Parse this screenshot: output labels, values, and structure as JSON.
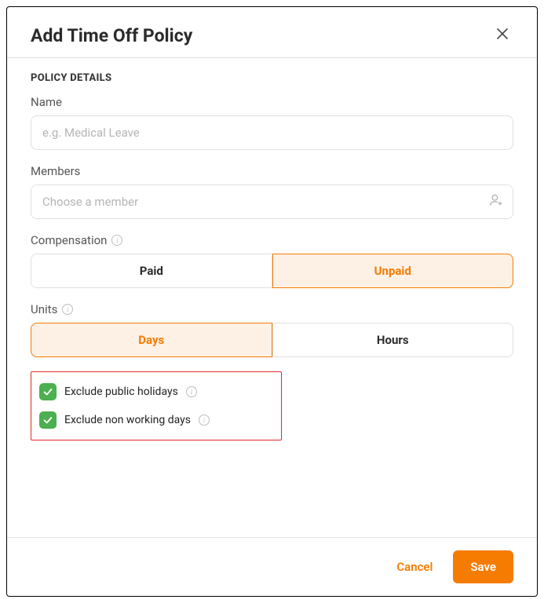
{
  "header": {
    "title": "Add Time Off Policy"
  },
  "section": {
    "heading": "POLICY DETAILS"
  },
  "name": {
    "label": "Name",
    "placeholder": "e.g. Medical Leave",
    "value": ""
  },
  "members": {
    "label": "Members",
    "placeholder": "Choose a member",
    "value": ""
  },
  "compensation": {
    "label": "Compensation",
    "options": {
      "paid": "Paid",
      "unpaid": "Unpaid"
    },
    "selected": "unpaid"
  },
  "units": {
    "label": "Units",
    "options": {
      "days": "Days",
      "hours": "Hours"
    },
    "selected": "days"
  },
  "checks": {
    "exclude_holidays_label": "Exclude public holidays",
    "exclude_nonworking_label": "Exclude non working days"
  },
  "footer": {
    "cancel": "Cancel",
    "save": "Save"
  },
  "icons": {
    "close": "close-icon",
    "info": "info-icon",
    "add_person": "person-plus-icon",
    "check": "checkmark-icon"
  },
  "colors": {
    "accent": "#f57c00",
    "success": "#4caf50",
    "highlight_border": "#e02a2a"
  }
}
